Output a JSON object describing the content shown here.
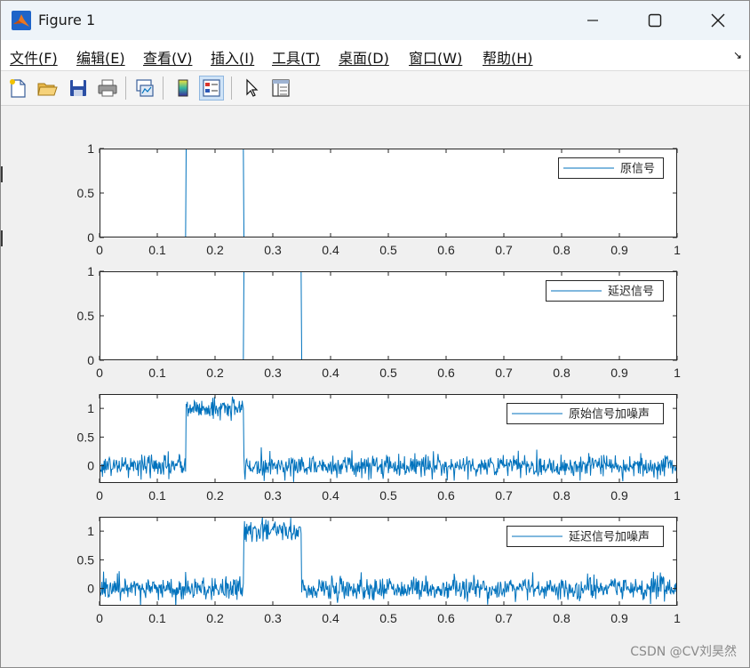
{
  "window": {
    "title": "Figure 1"
  },
  "menu": [
    {
      "label": "文件(F)"
    },
    {
      "label": "编辑(E)"
    },
    {
      "label": "查看(V)"
    },
    {
      "label": "插入(I)"
    },
    {
      "label": "工具(T)"
    },
    {
      "label": "桌面(D)"
    },
    {
      "label": "窗口(W)"
    },
    {
      "label": "帮助(H)"
    }
  ],
  "toolbar": [
    {
      "icon": "new-figure-icon"
    },
    {
      "icon": "open-folder-icon"
    },
    {
      "icon": "save-icon"
    },
    {
      "icon": "print-icon"
    },
    {
      "icon": "link-plot-icon"
    },
    {
      "icon": "colorbar-icon"
    },
    {
      "icon": "legend-icon",
      "active": true
    },
    {
      "icon": "pointer-icon"
    },
    {
      "icon": "property-inspector-icon"
    }
  ],
  "colors": {
    "line": "#0072BD",
    "axes_bg": "#ffffff",
    "figure_bg": "#f0f0f0"
  },
  "watermark": "CSDN @CV刘昊然",
  "chart_data": [
    {
      "type": "line",
      "legend": [
        "原信号"
      ],
      "legend_position": "top-right",
      "xlim": [
        0,
        1
      ],
      "ylim": [
        0,
        1
      ],
      "xticks": [
        "0",
        "0.1",
        "0.2",
        "0.3",
        "0.4",
        "0.5",
        "0.6",
        "0.7",
        "0.8",
        "0.9",
        "1"
      ],
      "yticks": [
        "0",
        "0.5",
        "1"
      ],
      "series": [
        {
          "name": "原信号",
          "x": [
            0,
            0.149,
            0.15,
            0.249,
            0.25,
            1
          ],
          "y": [
            0,
            0,
            1,
            1,
            0,
            0
          ]
        }
      ]
    },
    {
      "type": "line",
      "legend": [
        "延迟信号"
      ],
      "legend_position": "top-right",
      "xlim": [
        0,
        1
      ],
      "ylim": [
        0,
        1
      ],
      "xticks": [
        "0",
        "0.1",
        "0.2",
        "0.3",
        "0.4",
        "0.5",
        "0.6",
        "0.7",
        "0.8",
        "0.9",
        "1"
      ],
      "yticks": [
        "0",
        "0.5",
        "1"
      ],
      "series": [
        {
          "name": "延迟信号",
          "x": [
            0,
            0.249,
            0.25,
            0.349,
            0.35,
            1
          ],
          "y": [
            0,
            0,
            1,
            1,
            0,
            0
          ]
        }
      ]
    },
    {
      "type": "line",
      "legend": [
        "原始信号加噪声"
      ],
      "legend_position": "top-right",
      "xlim": [
        0,
        1
      ],
      "ylim": [
        -0.3,
        1.25
      ],
      "xticks": [
        "0",
        "0.1",
        "0.2",
        "0.3",
        "0.4",
        "0.5",
        "0.6",
        "0.7",
        "0.8",
        "0.9",
        "1"
      ],
      "yticks": [
        "0",
        "0.5",
        "1"
      ],
      "noise_std": 0.1,
      "series": [
        {
          "name": "原始信号加噪声",
          "pulse_start": 0.15,
          "pulse_end": 0.25,
          "amplitude": 1,
          "samples": 1000
        }
      ]
    },
    {
      "type": "line",
      "legend": [
        "延迟信号加噪声"
      ],
      "legend_position": "top-right",
      "xlim": [
        0,
        1
      ],
      "ylim": [
        -0.3,
        1.25
      ],
      "xticks": [
        "0",
        "0.1",
        "0.2",
        "0.3",
        "0.4",
        "0.5",
        "0.6",
        "0.7",
        "0.8",
        "0.9",
        "1"
      ],
      "yticks": [
        "0",
        "0.5",
        "1"
      ],
      "noise_std": 0.1,
      "series": [
        {
          "name": "延迟信号加噪声",
          "pulse_start": 0.25,
          "pulse_end": 0.35,
          "amplitude": 1,
          "samples": 1000
        }
      ]
    }
  ]
}
